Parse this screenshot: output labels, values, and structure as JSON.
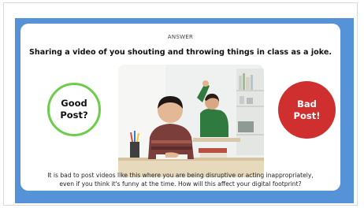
{
  "slide": {
    "label": "ANSWER",
    "question": "Sharing a video of you shouting and throwing things in class as a joke.",
    "good_option": {
      "line1": "Good",
      "line2": "Post?"
    },
    "bad_option": {
      "line1": "Bad",
      "line2": "Post!"
    },
    "explanation": {
      "line1": "It is bad to post videos like this where you are being disruptive or acting inappropriately,",
      "line2": "even if you think it's funny at the time. How will this affect your digital footprint?"
    },
    "colors": {
      "background": "#5592d8",
      "good_ring": "#6dcd4b",
      "bad_fill": "#cf2f2f"
    }
  }
}
